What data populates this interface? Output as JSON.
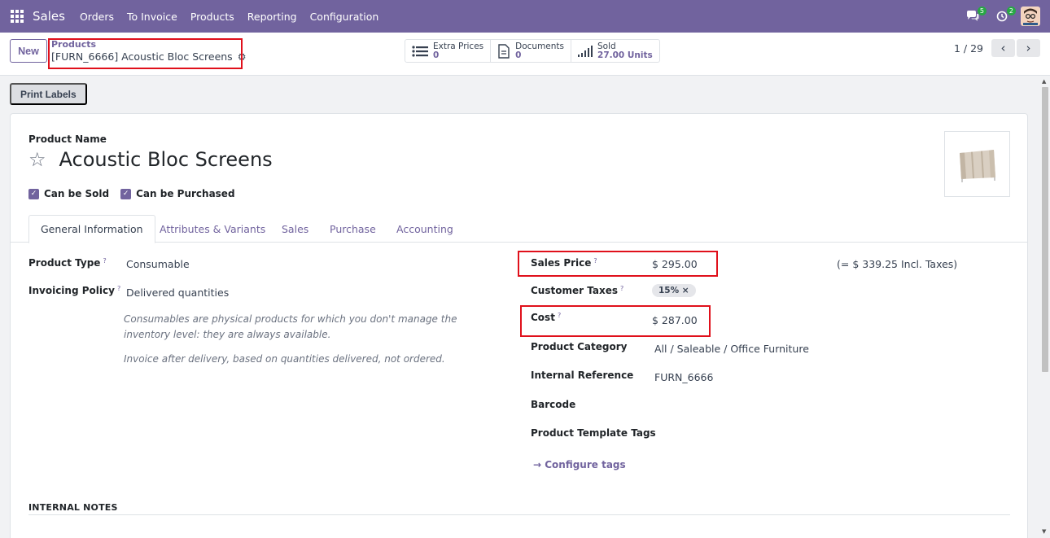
{
  "nav": {
    "brand": "Sales",
    "menu": [
      "Orders",
      "To Invoice",
      "Products",
      "Reporting",
      "Configuration"
    ],
    "chat_badge": "5",
    "activity_badge": "2"
  },
  "control": {
    "new_label": "New",
    "breadcrumb_parent": "Products",
    "breadcrumb_current": "[FURN_6666] Acoustic Bloc Screens",
    "smart_buttons": [
      {
        "label": "Extra Prices",
        "value": "0",
        "icon": "list-icon"
      },
      {
        "label": "Documents",
        "value": "0",
        "icon": "document-icon"
      },
      {
        "label": "Sold",
        "value": "27.00 Units",
        "icon": "bar-chart-icon"
      }
    ],
    "pager": "1 / 29"
  },
  "status": {
    "print_labels": "Print Labels"
  },
  "form": {
    "product_name_label": "Product Name",
    "product_name": "Acoustic Bloc Screens",
    "can_be_sold": "Can be Sold",
    "can_be_purchased": "Can be Purchased",
    "tabs": [
      "General Information",
      "Attributes & Variants",
      "Sales",
      "Purchase",
      "Accounting"
    ],
    "left": {
      "product_type_label": "Product Type",
      "product_type": "Consumable",
      "invoicing_policy_label": "Invoicing Policy",
      "invoicing_policy": "Delivered quantities",
      "help1": "Consumables are physical products for which you don't manage the inventory level: they are always available.",
      "help2": "Invoice after delivery, based on quantities delivered, not ordered."
    },
    "right": {
      "sales_price_label": "Sales Price",
      "sales_price": "$ 295.00",
      "incl_taxes": "(= $ 339.25 Incl. Taxes)",
      "customer_taxes_label": "Customer Taxes",
      "customer_tax_tag": "15% ×",
      "cost_label": "Cost",
      "cost": "$ 287.00",
      "category_label": "Product Category",
      "category": "All / Saleable / Office Furniture",
      "internal_ref_label": "Internal Reference",
      "internal_ref": "FURN_6666",
      "barcode_label": "Barcode",
      "tags_label": "Product Template Tags",
      "configure_tags": "→ Configure tags"
    },
    "internal_notes": "INTERNAL NOTES",
    "help_marker": "?"
  },
  "colors": {
    "primary": "#71639e",
    "highlight": "#e0101b",
    "badge": "#28a745"
  }
}
